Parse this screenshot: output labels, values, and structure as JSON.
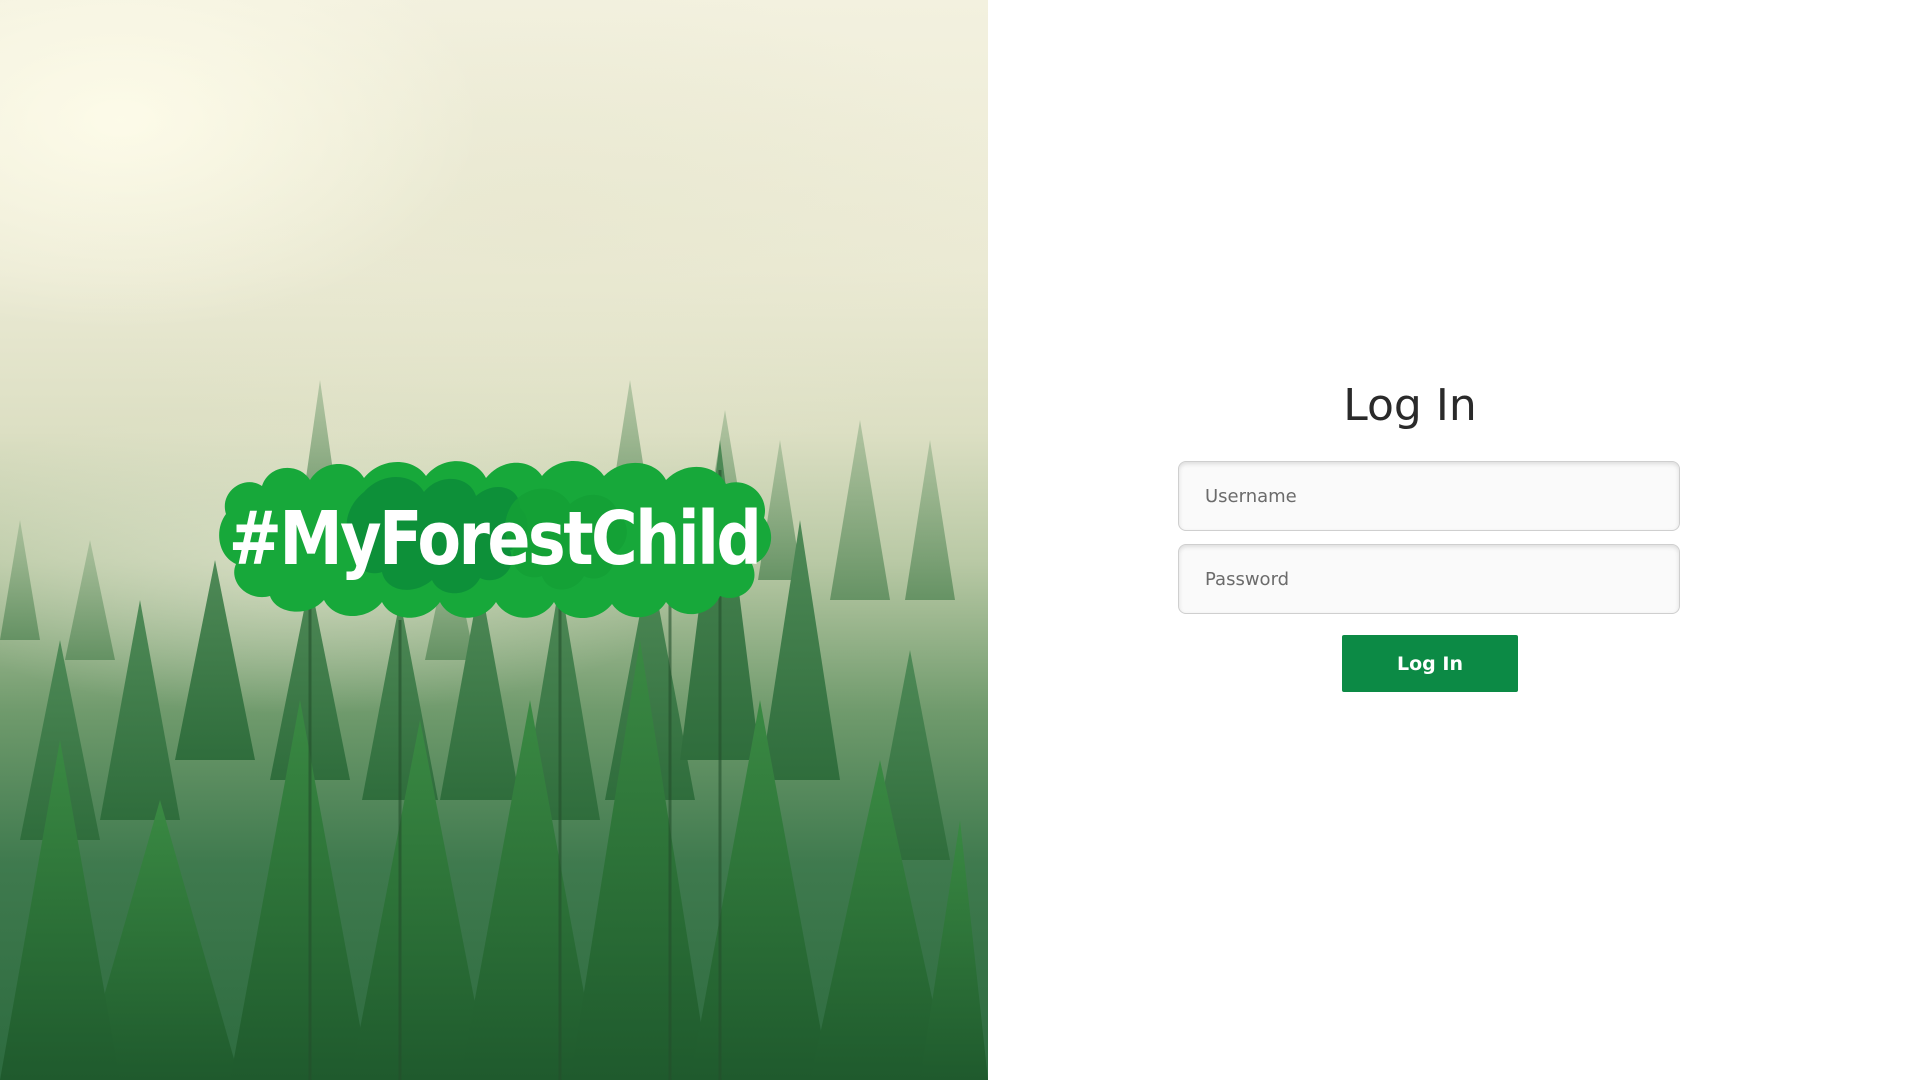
{
  "brand": {
    "hashtag": "#MyForestChild",
    "colors": {
      "splash_light": "#17a83a",
      "splash_dark": "#0b8a3a",
      "text": "#ffffff"
    }
  },
  "hero": {
    "image": "misty-pine-forest"
  },
  "login": {
    "title": "Log In",
    "username_placeholder": "Username",
    "password_placeholder": "Password",
    "username_value": "",
    "password_value": "",
    "submit_label": "Log In",
    "accent_color": "#0c8a45"
  }
}
